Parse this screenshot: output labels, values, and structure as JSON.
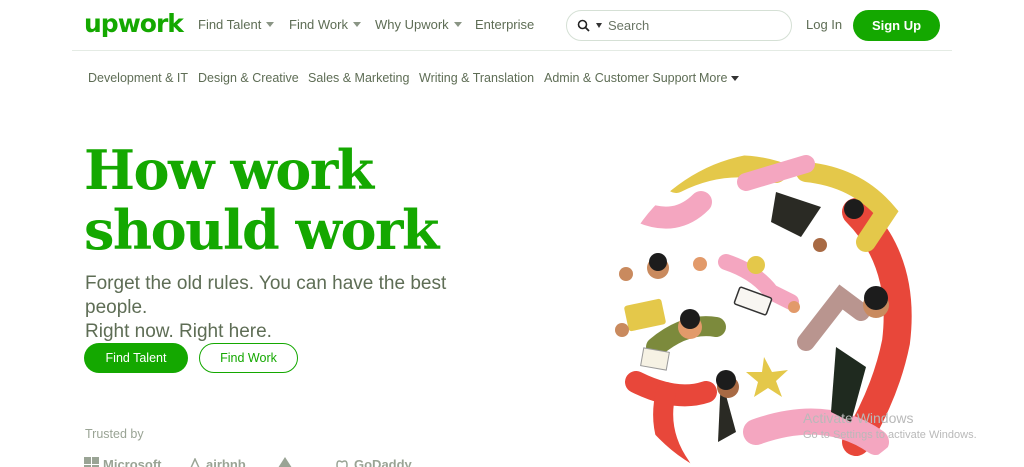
{
  "header": {
    "logo": "upwork",
    "nav": [
      {
        "label": "Find Talent",
        "dropdown": true
      },
      {
        "label": "Find Work",
        "dropdown": true
      },
      {
        "label": "Why Upwork",
        "dropdown": true
      },
      {
        "label": "Enterprise",
        "dropdown": false
      }
    ],
    "search": {
      "placeholder": "Search",
      "icon": "search-icon"
    },
    "login": "Log In",
    "signup": "Sign Up"
  },
  "categories": {
    "items": [
      "Development & IT",
      "Design & Creative",
      "Sales & Marketing",
      "Writing & Translation",
      "Admin & Customer Support"
    ],
    "more": "More"
  },
  "hero": {
    "title_line1": "How work",
    "title_line2": "should work",
    "subtitle_line1": "Forget the old rules. You can have the best people.",
    "subtitle_line2": "Right now. Right here.",
    "primary_cta": "Find Talent",
    "secondary_cta": "Find Work",
    "trusted_by": "Trusted by",
    "brands": [
      "Microsoft",
      "airbnb",
      "GoDaddy"
    ]
  },
  "watermark": {
    "line1": "Activate Windows",
    "line2": "Go to Settings to activate Windows."
  },
  "colors": {
    "brand_green": "#14a800",
    "text_gray": "#5e6d55",
    "illus_red": "#e8473a",
    "illus_yellow": "#e4c84a",
    "illus_pink": "#f4a6c0",
    "illus_olive": "#7c8a3c",
    "illus_mauve": "#b9958f"
  }
}
